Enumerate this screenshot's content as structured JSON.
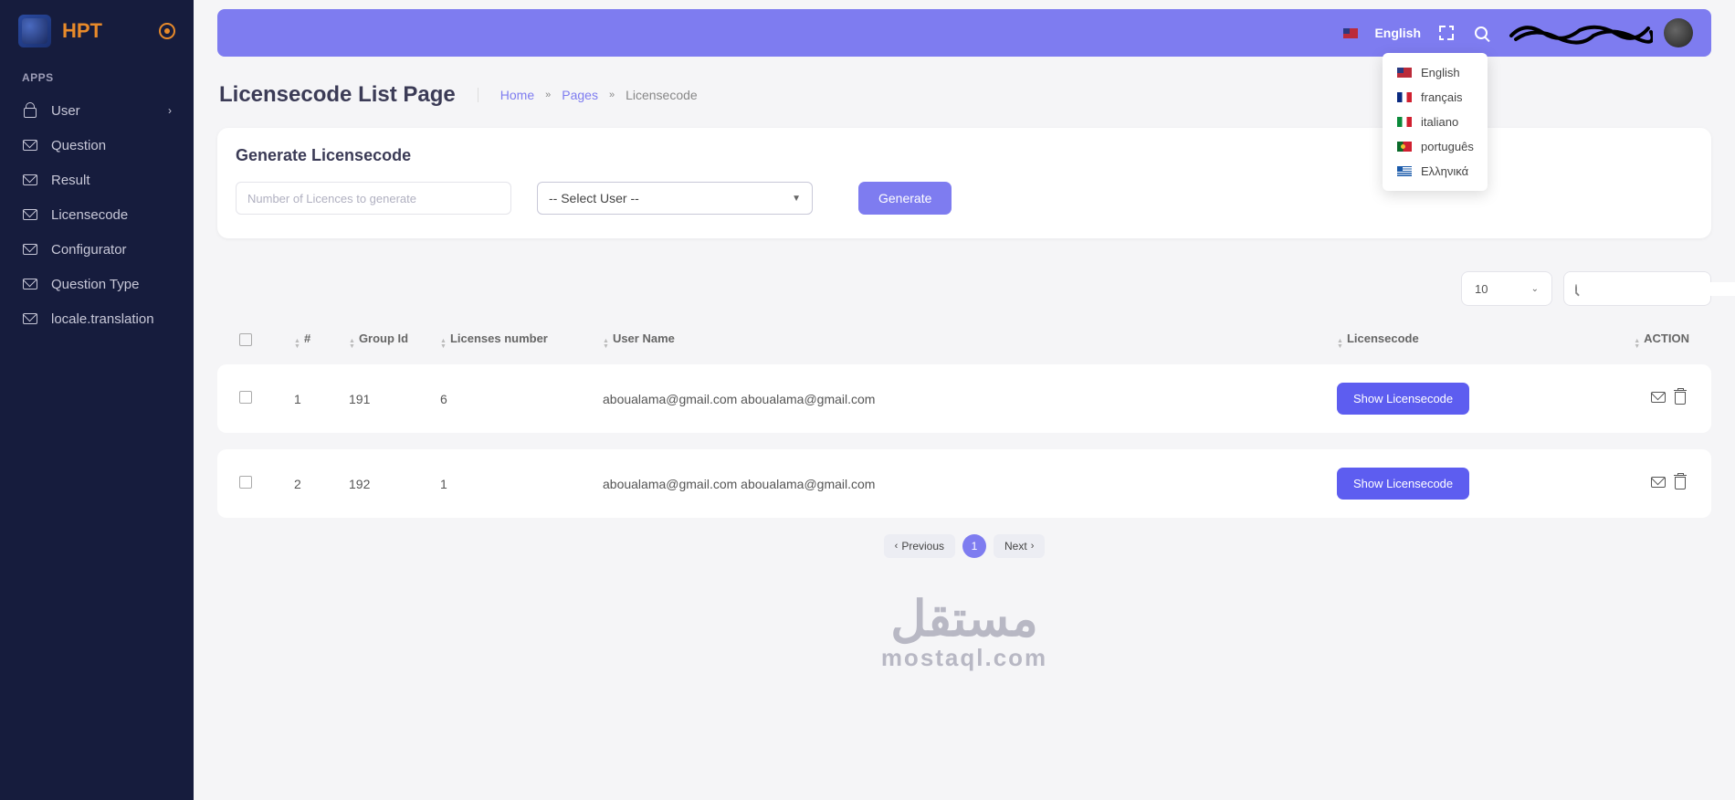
{
  "brand": {
    "name": "HPT"
  },
  "sidebar": {
    "section_title": "APPS",
    "items": [
      {
        "label": "User",
        "icon": "lock",
        "has_children": true
      },
      {
        "label": "Question",
        "icon": "mail",
        "has_children": false
      },
      {
        "label": "Result",
        "icon": "mail",
        "has_children": false
      },
      {
        "label": "Licensecode",
        "icon": "mail",
        "has_children": false
      },
      {
        "label": "Configurator",
        "icon": "mail",
        "has_children": false
      },
      {
        "label": "Question Type",
        "icon": "mail",
        "has_children": false
      },
      {
        "label": "locale.translation",
        "icon": "mail",
        "has_children": false
      }
    ]
  },
  "topbar": {
    "language_current": "English",
    "languages": [
      {
        "label": "English",
        "code": "us"
      },
      {
        "label": "français",
        "code": "fr"
      },
      {
        "label": "italiano",
        "code": "it"
      },
      {
        "label": "português",
        "code": "pt"
      },
      {
        "label": "Ελληνικά",
        "code": "gr"
      }
    ]
  },
  "page": {
    "title": "Licensecode List Page",
    "breadcrumb": {
      "home": "Home",
      "mid": "Pages",
      "current": "Licensecode"
    }
  },
  "generate_card": {
    "title": "Generate Licensecode",
    "input_placeholder": "Number of Licences to generate",
    "select_placeholder": "-- Select User --",
    "button": "Generate"
  },
  "table": {
    "page_size": "10",
    "columns": {
      "num": "#",
      "group": "Group Id",
      "licenses": "Licenses number",
      "user": "User Name",
      "code": "Licensecode",
      "action": "ACTION"
    },
    "show_button": "Show Licensecode",
    "rows": [
      {
        "num": "1",
        "group": "191",
        "licenses": "6",
        "user": "aboualama@gmail.com aboualama@gmail.com"
      },
      {
        "num": "2",
        "group": "192",
        "licenses": "1",
        "user": "aboualama@gmail.com aboualama@gmail.com"
      }
    ]
  },
  "pagination": {
    "previous": "Previous",
    "next": "Next",
    "current": "1"
  },
  "watermark": {
    "arabic": "مستقل",
    "latin": "mostaql.com"
  }
}
